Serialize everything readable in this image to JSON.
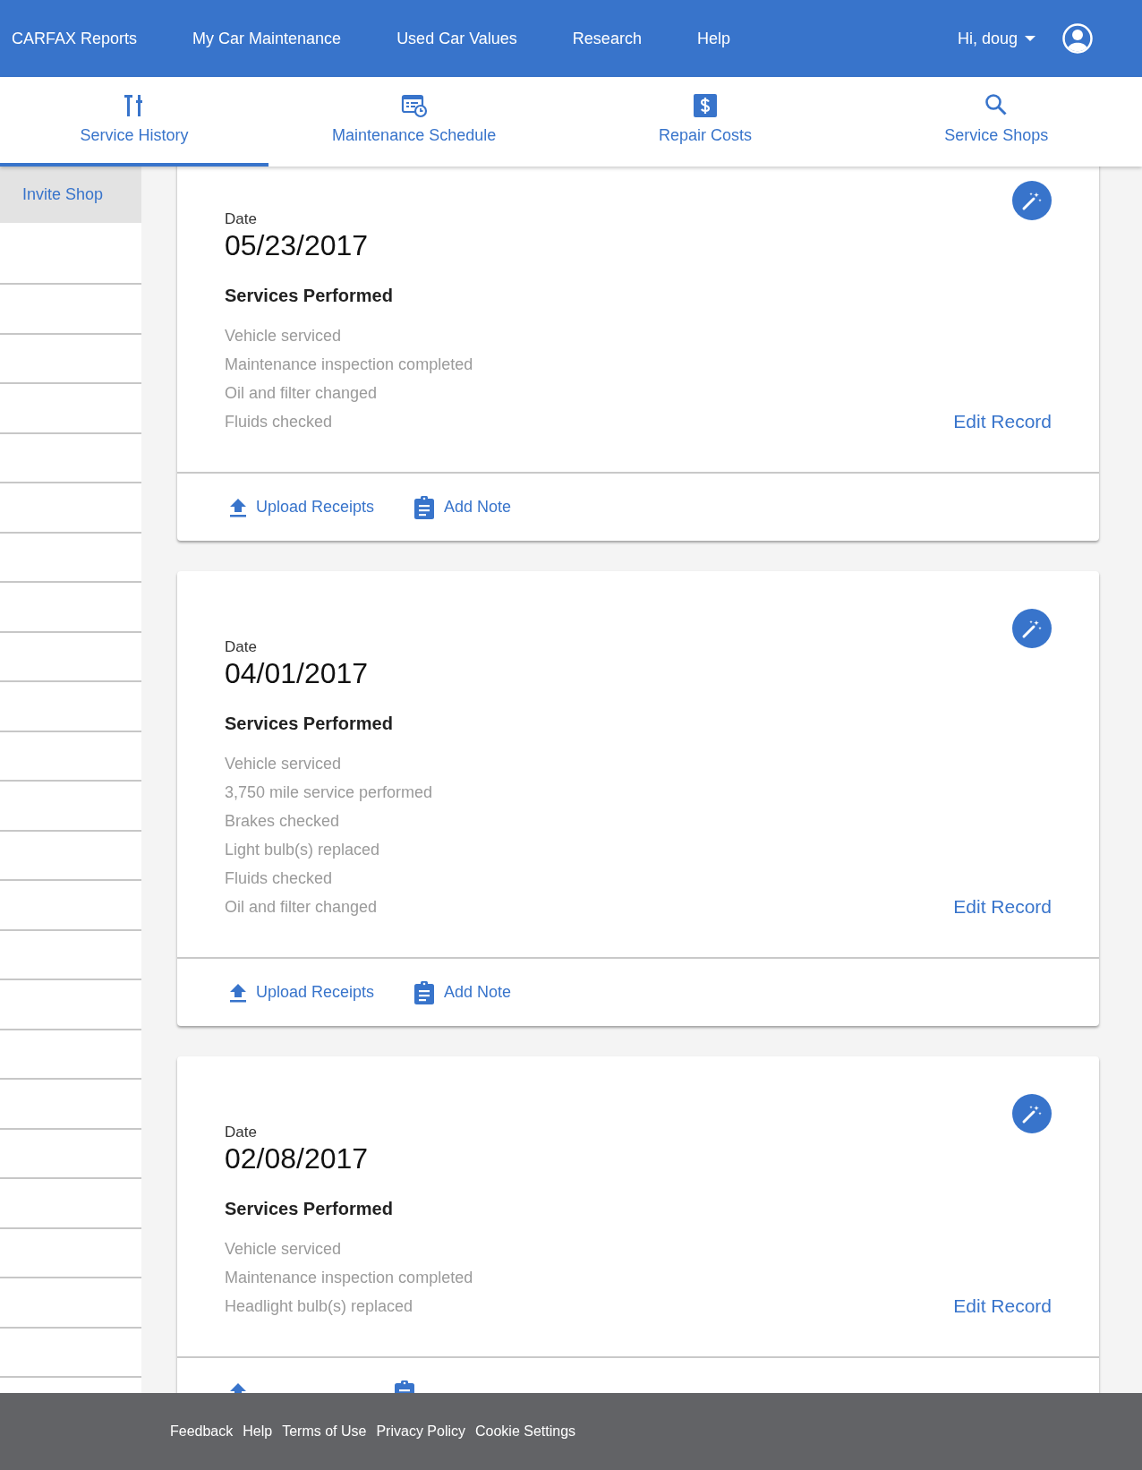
{
  "nav": {
    "links": [
      "CARFAX Reports",
      "My Car Maintenance",
      "Used Car Values",
      "Research",
      "Help"
    ],
    "greeting": "Hi, doug"
  },
  "tabs": [
    {
      "label": "Service History",
      "kind": "tools",
      "selected": true
    },
    {
      "label": "Maintenance Schedule",
      "kind": "schedule",
      "selected": false
    },
    {
      "label": "Repair Costs",
      "kind": "costs",
      "selected": false
    },
    {
      "label": "Service Shops",
      "kind": "shops",
      "selected": false
    }
  ],
  "sidebar": {
    "items": [
      "Invite Shop"
    ]
  },
  "records": [
    {
      "date_label": "Date",
      "date": "05/23/2017",
      "services_title": "Services Performed",
      "services": [
        "Vehicle serviced",
        "Maintenance inspection completed",
        "Oil and filter changed",
        "Fluids checked"
      ],
      "edit_label": "Edit Record",
      "actions": [
        {
          "kind": "upload",
          "label": "Upload Receipts"
        },
        {
          "kind": "note",
          "label": "Add Note"
        }
      ]
    },
    {
      "date_label": "Date",
      "date": "04/01/2017",
      "services_title": "Services Performed",
      "services": [
        "Vehicle serviced",
        "3,750 mile service performed",
        "Brakes checked",
        "Light bulb(s) replaced",
        "Fluids checked",
        "Oil and filter changed"
      ],
      "edit_label": "Edit Record",
      "actions": [
        {
          "kind": "upload",
          "label": "Upload Receipts"
        },
        {
          "kind": "note",
          "label": "Add Note"
        }
      ]
    },
    {
      "date_label": "Date",
      "date": "02/08/2017",
      "services_title": "Services Performed",
      "services": [
        "Vehicle serviced",
        "Maintenance inspection completed",
        "Headlight bulb(s) replaced"
      ],
      "edit_label": "Edit Record",
      "actions": [
        {
          "kind": "upload"
        },
        {
          "kind": "note"
        }
      ]
    }
  ],
  "footer": {
    "links": [
      "Feedback",
      "Help",
      "Terms of Use",
      "Privacy Policy",
      "Cookie Settings"
    ]
  }
}
